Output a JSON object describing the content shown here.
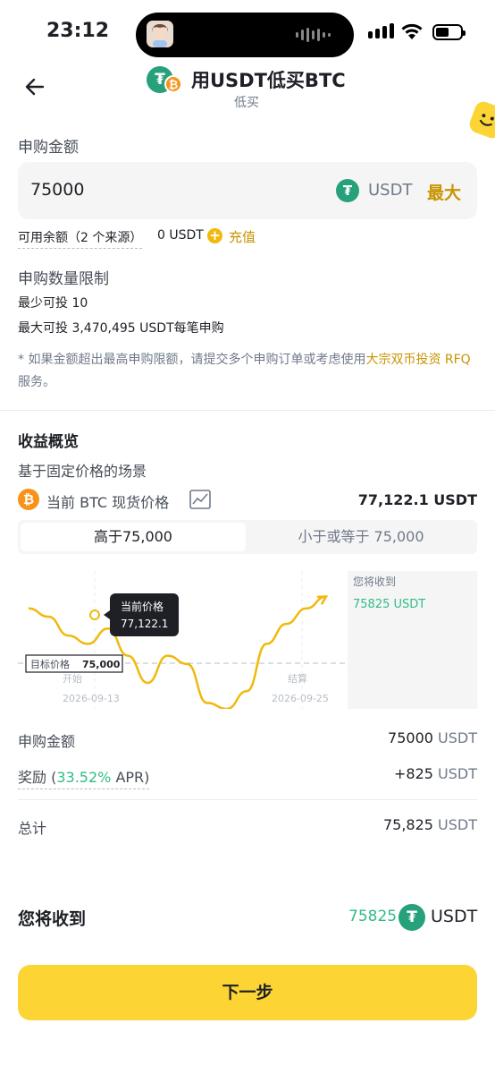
{
  "status": {
    "time": "23:12"
  },
  "header": {
    "title": "用USDT低买BTC",
    "subtitle": "低买"
  },
  "amount": {
    "label": "申购金额",
    "value": "75000",
    "unit": "USDT",
    "max_label": "最大",
    "available_label": "可用余额（2 个来源）",
    "available_value": "0 USDT",
    "deposit_label": "充值"
  },
  "limits": {
    "title": "申购数量限制",
    "min": "最少可投 10",
    "max": "最大可投 3,470,495 USDT每笔申购",
    "note_prefix": "* 如果金额超出最高申购限额，请提交多个申购订单或考虑使用",
    "note_link": "大宗双币投资 RFQ",
    "note_suffix": " 服务。"
  },
  "overview": {
    "title": "收益概览",
    "scenario": "基于固定价格的场景",
    "price_label": "当前 BTC 现货价格",
    "price_value": "77,122.1 USDT",
    "tab_above": "高于75,000",
    "tab_below": "小于或等于 75,000"
  },
  "chart_data": {
    "type": "line",
    "tooltip_title": "当前价格",
    "tooltip_value": "77,122.1",
    "target_label": "目标价格",
    "target_value": "75,000",
    "start_label": "开始",
    "start_date": "2026-09-13",
    "settle_label": "结算",
    "settle_date": "2026-09-25",
    "receive_label": "您将收到",
    "receive_value": "75825 USDT",
    "series": [
      {
        "values": [
          0.85,
          0.78,
          0.62,
          0.55,
          0.68,
          0.45,
          0.22,
          0.45,
          0.38,
          0.05,
          0.0,
          0.15,
          0.55,
          0.72,
          0.85,
          0.95
        ]
      }
    ],
    "colors": {
      "line": "#f0b90b",
      "target": "#b7bdc6",
      "receive": "#2ebd85"
    }
  },
  "summary": {
    "amount_label": "申购金额",
    "amount_value": "75000",
    "amount_unit": "USDT",
    "reward_label": "奖励",
    "reward_apr": "33.52%",
    "reward_apr_suffix": "APR",
    "reward_value": "+825",
    "reward_unit": "USDT",
    "total_label": "总计",
    "total_value": "75,825",
    "total_unit": "USDT"
  },
  "receive": {
    "label": "您将收到",
    "value": "75825",
    "unit": "USDT"
  },
  "cta": {
    "label": "下一步"
  }
}
